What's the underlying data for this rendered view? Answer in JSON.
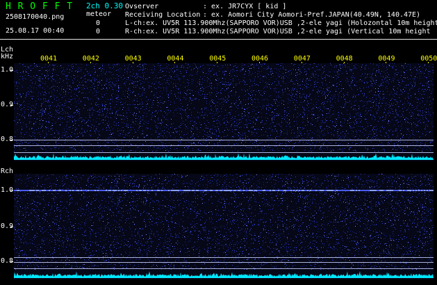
{
  "header": {
    "title": "H R O F F T",
    "version": "2ch 0.30",
    "filename": "2508170040.png",
    "mode": "meteor",
    "datetime": "25.08.17 00:40",
    "count_l": "0",
    "count_r": "0",
    "observer_label": "Ovserver",
    "observer_value": ": ex. JR7CYX [ kid ]",
    "location_label": "Receiving Location",
    "location_value": ": ex. Aomori City Aomori-Pref.JAPAN(40.49N, 140.47E)",
    "lch_info": "L-ch:ex. UV5R 113.900Mhz(SAPPORO VOR)USB ,2-ele yagi (Holozontal 10m height",
    "rch_info": "R-ch:ex. UV5R 113.900Mhz(SAPPORO VOR)USB ,2-ele yagi (Vertical 10m height"
  },
  "time_axis": [
    "0041",
    "0042",
    "0043",
    "0044",
    "0045",
    "0046",
    "0047",
    "0048",
    "0049",
    "0050"
  ],
  "lch": {
    "label": "Lch",
    "unit": "kHz",
    "y_ticks": [
      "1.0",
      "0.9",
      "0.8"
    ]
  },
  "rch": {
    "label": "Rch",
    "y_ticks": [
      "1.0",
      "0.9",
      "0.8"
    ]
  },
  "colors": {
    "title": "#00ff00",
    "version": "#00ffff",
    "info": "#ffffff",
    "time_labels": "#ffff00",
    "spectrum": "#00ffff",
    "noise": "#2d3cc8",
    "background": "#000000"
  }
}
